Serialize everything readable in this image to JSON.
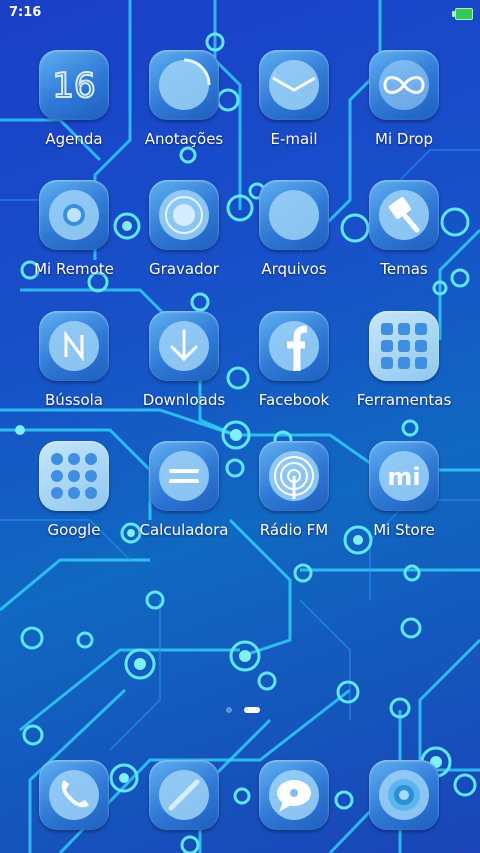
{
  "status_bar": {
    "time": "7:16",
    "battery_icon": "battery-icon"
  },
  "apps": [
    {
      "label": "Agenda",
      "icon": "calendar-icon"
    },
    {
      "label": "Anotações",
      "icon": "notes-icon"
    },
    {
      "label": "E-mail",
      "icon": "email-icon"
    },
    {
      "label": "Mi Drop",
      "icon": "infinity-icon"
    },
    {
      "label": "Mi Remote",
      "icon": "remote-icon"
    },
    {
      "label": "Gravador",
      "icon": "recorder-icon"
    },
    {
      "label": "Arquivos",
      "icon": "folder-icon"
    },
    {
      "label": "Temas",
      "icon": "brush-icon"
    },
    {
      "label": "Bússola",
      "icon": "compass-icon"
    },
    {
      "label": "Downloads",
      "icon": "download-icon"
    },
    {
      "label": "Facebook",
      "icon": "facebook-icon"
    },
    {
      "label": "Ferramentas",
      "icon": "tools-folder-icon"
    },
    {
      "label": "Google",
      "icon": "google-folder-icon"
    },
    {
      "label": "Calculadora",
      "icon": "calculator-icon"
    },
    {
      "label": "Rádio FM",
      "icon": "radio-icon"
    },
    {
      "label": "Mi Store",
      "icon": "mi-store-icon"
    }
  ],
  "calendar_day": "16",
  "mi_logo": "mi",
  "dock": [
    {
      "icon": "phone-icon"
    },
    {
      "icon": "browser-icon"
    },
    {
      "icon": "messages-icon"
    },
    {
      "icon": "camera-icon"
    }
  ],
  "page_indicator": {
    "pages": 2,
    "active": 2
  },
  "colors": {
    "wallpaper_base": "#1a44c0",
    "circuit": "#36e0ff",
    "icon_top": "#5fb0f2",
    "icon_bottom": "#1f5fbf",
    "battery": "#34c759"
  }
}
